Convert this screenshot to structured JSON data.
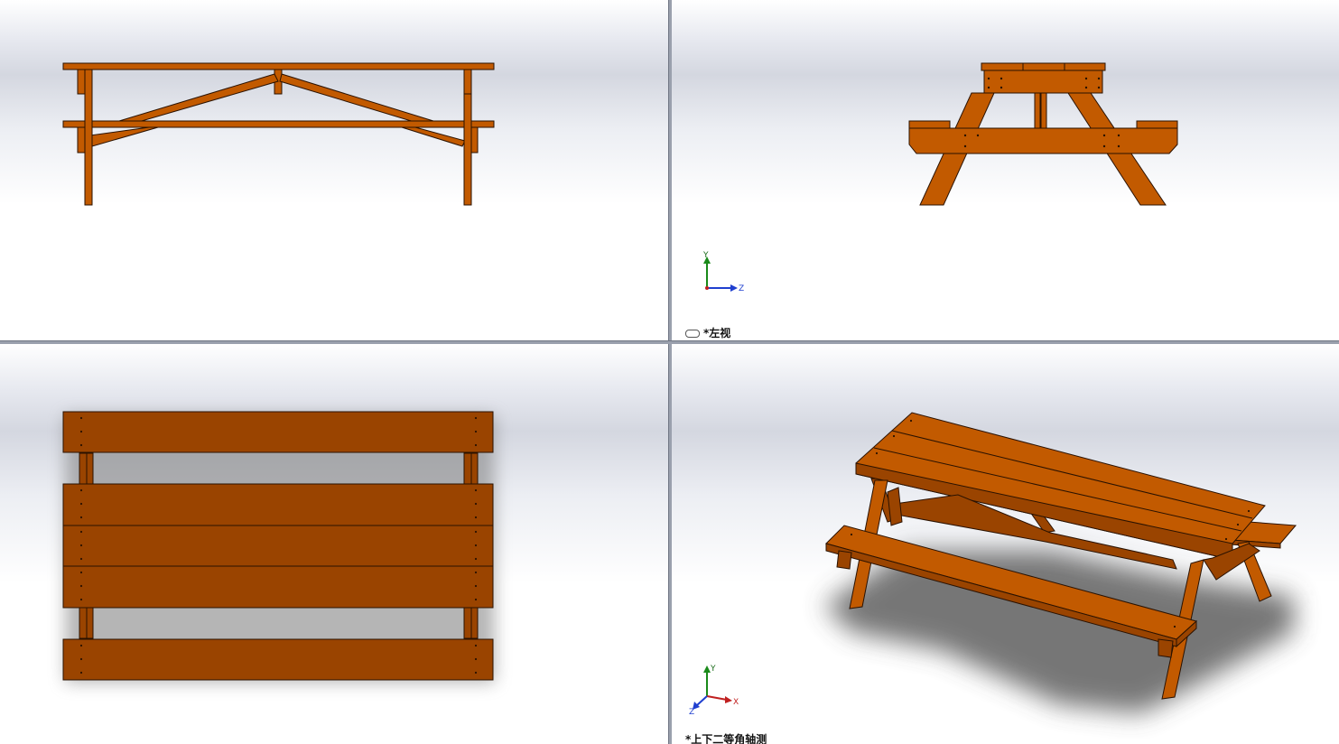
{
  "viewports": {
    "top_left": {
      "name": "front-view"
    },
    "top_right": {
      "name": "left-view",
      "label_prefix": "*",
      "label": "左视",
      "triad": {
        "x": "",
        "y": "Y",
        "z": "Z"
      }
    },
    "bottom_left": {
      "name": "top-view"
    },
    "bottom_right": {
      "name": "dimetric-view",
      "label_prefix": "*",
      "label": "上下二等角轴测",
      "triad": {
        "x": "X",
        "y": "Y",
        "z": "Z"
      }
    }
  },
  "colors": {
    "wood": "#c25a00",
    "wood_dark": "#9a4400",
    "outline": "#2a1200",
    "shadow": "#5a5a5a"
  }
}
